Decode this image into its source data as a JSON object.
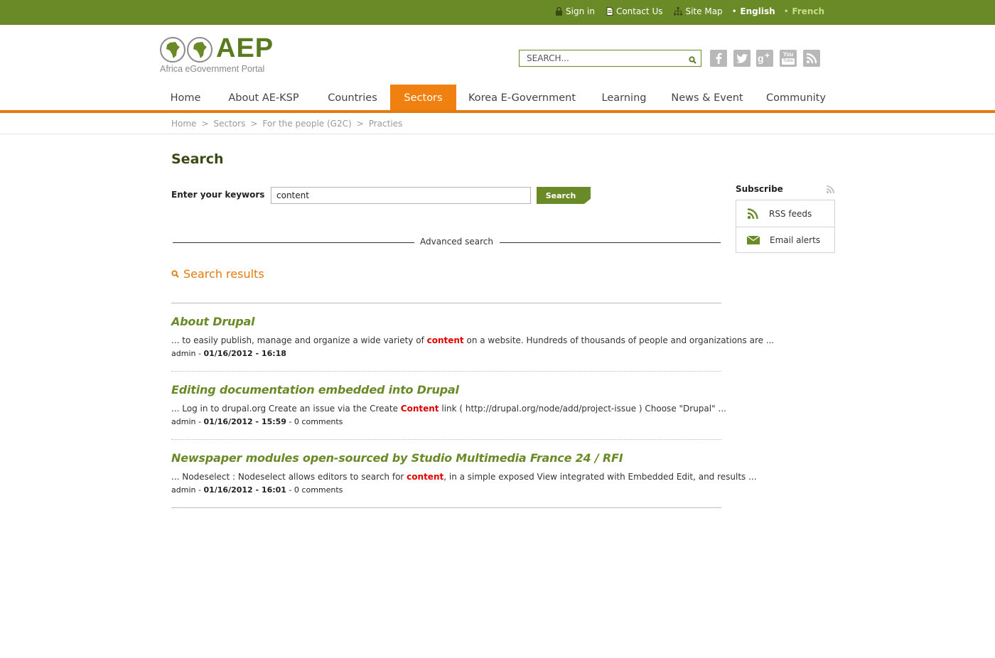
{
  "topbar": {
    "links": [
      {
        "label": "Sign in",
        "icon": "lock-icon"
      },
      {
        "label": "Contact Us",
        "icon": "document-icon"
      },
      {
        "label": "Site Map",
        "icon": "sitemap-icon"
      }
    ],
    "lang_english": "English",
    "lang_french": "French",
    "bar_color": "#6a8a27"
  },
  "logo": {
    "title": "AEP",
    "subtitle": "Africa eGovernment Portal"
  },
  "header_search": {
    "placeholder": "SEARCH..."
  },
  "social": [
    "facebook-icon",
    "twitter-icon",
    "google-plus-icon",
    "youtube-icon",
    "rss-icon"
  ],
  "nav": [
    {
      "label": "Home"
    },
    {
      "label": "About  AE-KSP"
    },
    {
      "label": "Countries"
    },
    {
      "label": "Sectors",
      "active": true
    },
    {
      "label": "Korea E-Government"
    },
    {
      "label": "Learning"
    },
    {
      "label": "News & Event"
    },
    {
      "label": "Community"
    }
  ],
  "breadcrumb": [
    "Home",
    "Sectors",
    "For the people (G2C)",
    "Practies"
  ],
  "breadcrumb_sep": ">",
  "page_title": "Search",
  "search_form": {
    "label": "Enter your keywors",
    "value": "content",
    "button": "Search"
  },
  "advanced_search": "Advanced search",
  "results_heading": "Search results",
  "results": [
    {
      "title": "About Drupal",
      "snippet_before": "... to easily publish, manage and organize a wide variety of ",
      "highlight": "content",
      "snippet_after": " on a website. Hundreds of thousands of people and organizations are ...",
      "author": "admin",
      "date": "01/16/2012 - 16:18",
      "comments": ""
    },
    {
      "title": "Editing documentation embedded into Drupal",
      "snippet_before": "... Log in to drupal.org Create an issue via the Create ",
      "highlight": "Content",
      "snippet_after": " link ( http://drupal.org/node/add/project-issue ) Choose \"Drupal\" ...",
      "author": "admin",
      "date": "01/16/2012 - 15:59",
      "comments": "0 comments"
    },
    {
      "title": "Newspaper modules open-sourced by Studio Multimedia France 24 / RFI",
      "snippet_before": "... Nodeselect : Nodeselect allows editors to search for ",
      "highlight": "content",
      "snippet_after": ", in a simple exposed View integrated with Embedded Edit, and results ...",
      "author": "admin",
      "date": "01/16/2012 - 16:01",
      "comments": "0 comments"
    }
  ],
  "subscribe": {
    "title": "Subscribe",
    "items": [
      {
        "label": "RSS feeds",
        "icon": "rss-icon"
      },
      {
        "label": "Email alerts",
        "icon": "envelope-icon"
      }
    ]
  },
  "colors": {
    "brand_green": "#6a8a27",
    "accent_orange": "#f0800f",
    "highlight_red": "#e00000"
  }
}
